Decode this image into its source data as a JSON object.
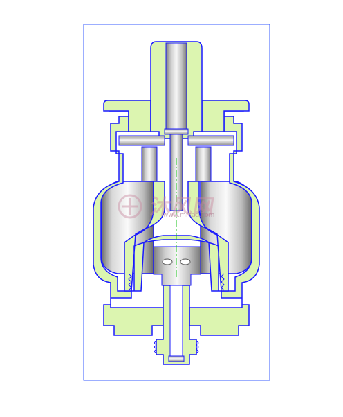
{
  "watermark": {
    "text": "沐风网",
    "url": "www.mfcad.com"
  },
  "colors": {
    "section_fill": "#dcf5b0",
    "outline": "#1a1aff",
    "centerline": "#19c319",
    "steel_light": "#f4f4f4",
    "steel_dark": "#8a8a8a"
  }
}
